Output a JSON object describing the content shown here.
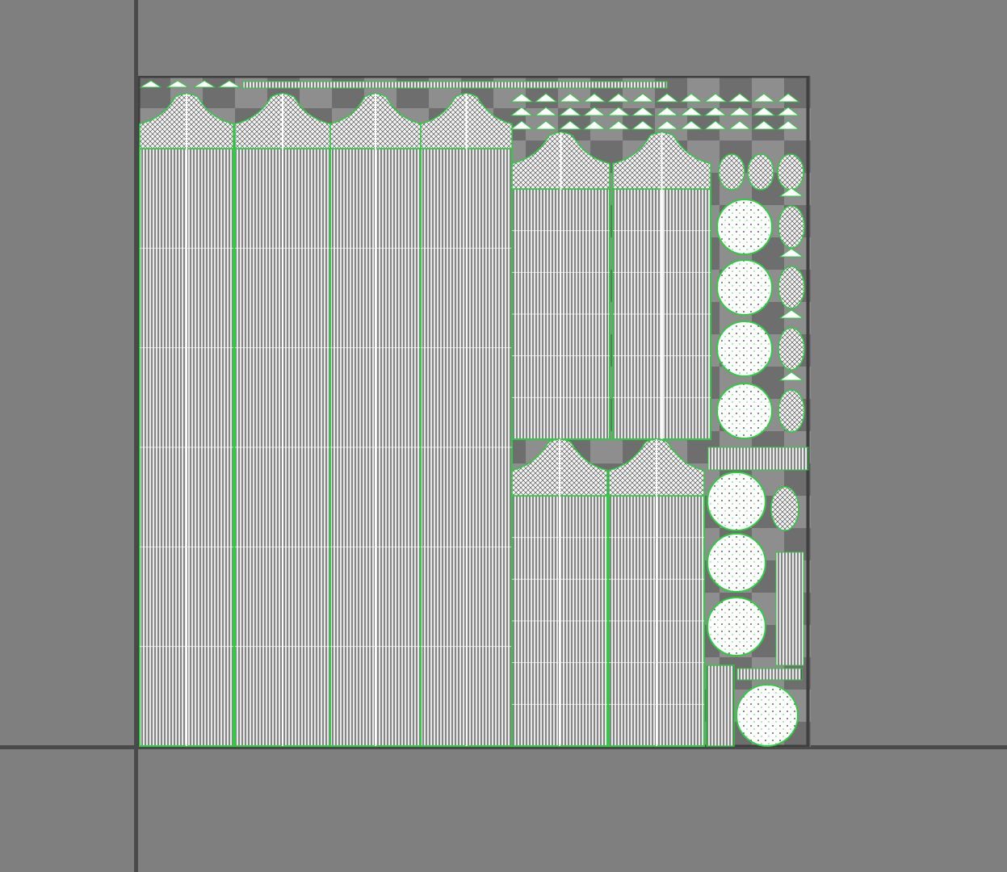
{
  "window": {
    "title": ""
  },
  "viewport": {
    "background_color": "#7f7f7f",
    "axis_color": "#4a4a4a",
    "frame_color": "#3f3f3f"
  },
  "uv_canvas": {
    "checker_light": "#8e8e8e",
    "checker_dark": "#6e6e6e",
    "wireframe_color": "#ffffff",
    "boundary_color": "#2ecc40"
  },
  "icons": {
    "uv-grid": "grid-icon"
  }
}
